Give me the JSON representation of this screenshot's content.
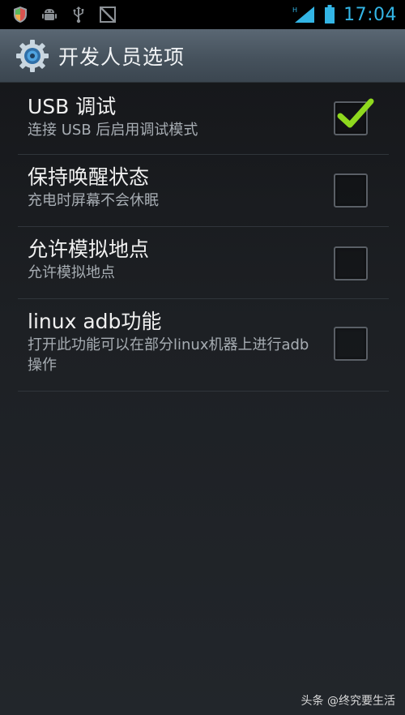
{
  "status_bar": {
    "time": "17:04",
    "network_label": "H",
    "left_icons": [
      "shield-icon",
      "android-icon",
      "usb-icon",
      "no-sim-icon"
    ],
    "right_icons": [
      "signal-icon",
      "battery-icon"
    ],
    "clock_color": "#33b5e5"
  },
  "header": {
    "title": "开发人员选项",
    "icon": "settings-gear-icon"
  },
  "preferences": [
    {
      "title": "USB 调试",
      "summary": "连接 USB 后启用调试模式",
      "checked": true
    },
    {
      "title": "保持唤醒状态",
      "summary": "充电时屏幕不会休眠",
      "checked": false
    },
    {
      "title": "允许模拟地点",
      "summary": "允许模拟地点",
      "checked": false
    },
    {
      "title": "linux adb功能",
      "summary": "打开此功能可以在部分linux机器上进行adb操作",
      "checked": false
    }
  ],
  "watermark": {
    "text": "头条 @终究要生活"
  },
  "colors": {
    "check_green": "#8fd81e",
    "accent_blue": "#33b5e5"
  }
}
